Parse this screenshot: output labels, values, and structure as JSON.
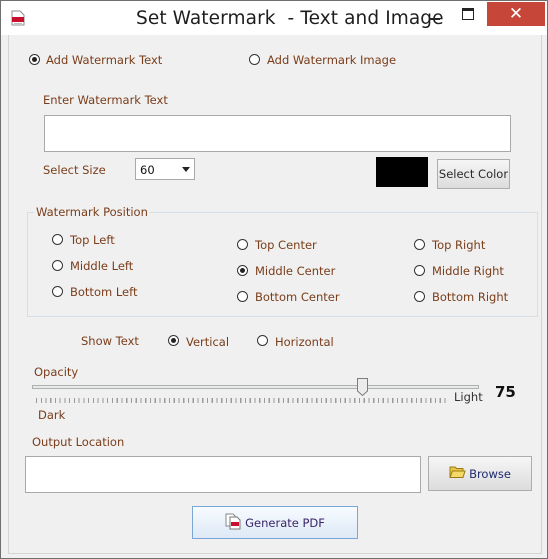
{
  "window": {
    "title": "Set Watermark  - Text and Image",
    "close_glyph": "✕"
  },
  "mode": {
    "text_label": "Add Watermark Text",
    "image_label": "Add Watermark Image",
    "selected": "text"
  },
  "watermark_text": {
    "label": "Enter Watermark Text",
    "value": ""
  },
  "size": {
    "label": "Select Size",
    "value": "60"
  },
  "color": {
    "swatch": "#000000",
    "button_label": "Select Color"
  },
  "position": {
    "group_title": "Watermark Position",
    "options": [
      "Top Left",
      "Top Center",
      "Top Right",
      "Middle Left",
      "Middle Center",
      "Middle Right",
      "Bottom Left",
      "Bottom Center",
      "Bottom Right"
    ],
    "selected": "Middle Center"
  },
  "orientation": {
    "label": "Show Text",
    "vertical_label": "Vertical",
    "horizontal_label": "Horizontal",
    "selected": "Vertical"
  },
  "opacity": {
    "label": "Opacity",
    "light_label": "Light",
    "dark_label": "Dark",
    "value": "75"
  },
  "output": {
    "label": "Output Location",
    "value": "",
    "browse_label": "Browse"
  },
  "generate_label": "Generate PDF",
  "icons": {
    "app": "pdf-app-icon",
    "folder": "folder-icon",
    "generate": "pdf-documents-icon"
  },
  "theme": {
    "label_accent": "#7a3d1a",
    "close_button": "#c7463a"
  }
}
